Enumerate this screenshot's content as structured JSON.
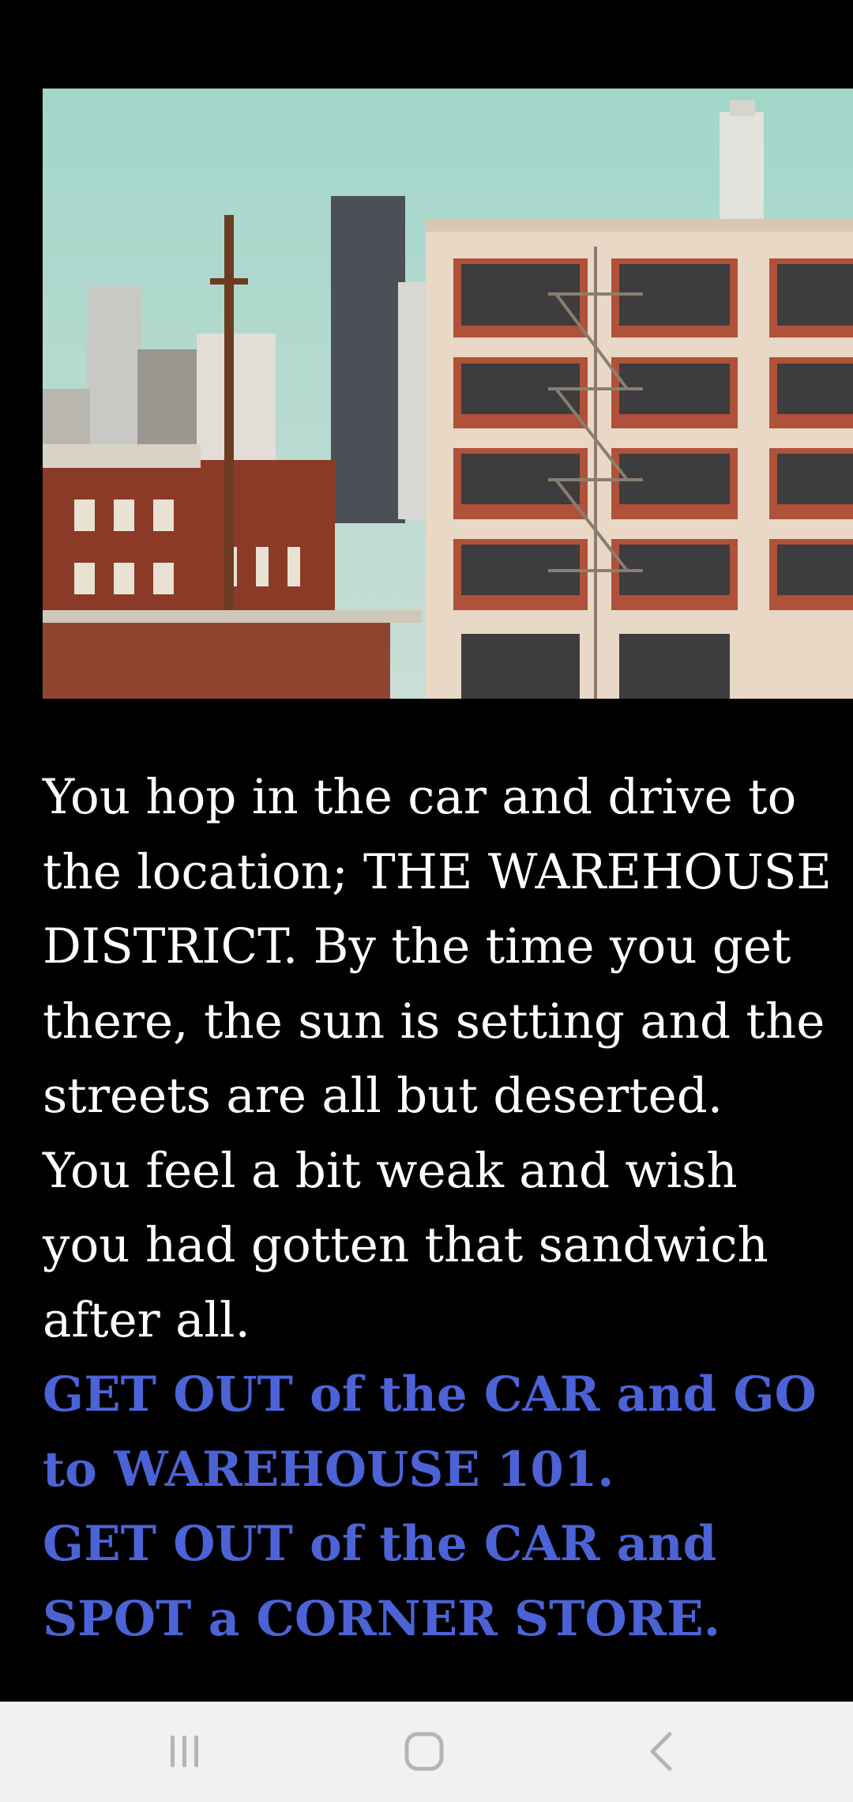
{
  "scene": {
    "image": {
      "subject": "brick warehouse buildings with city skyline behind"
    },
    "paragraphs": [
      "You hop in the car and drive to the location; THE WAREHOUSE DISTRICT. By the time you get there, the sun is setting and the streets are all but deserted.",
      "You feel a bit weak and wish you had gotten that sandwich after all."
    ],
    "choices": [
      "GET OUT of the CAR and GO to WAREHOUSE 101.",
      "GET OUT of the CAR and SPOT a CORNER STORE."
    ]
  },
  "navbar": {
    "icons": [
      "recent-apps-icon",
      "home-icon",
      "back-icon"
    ]
  },
  "colors": {
    "background": "#000000",
    "text": "#ffffff",
    "choice_link": "#4b63d6",
    "navbar": "#f1f1f1",
    "nav_icon": "#b5b5b5"
  }
}
